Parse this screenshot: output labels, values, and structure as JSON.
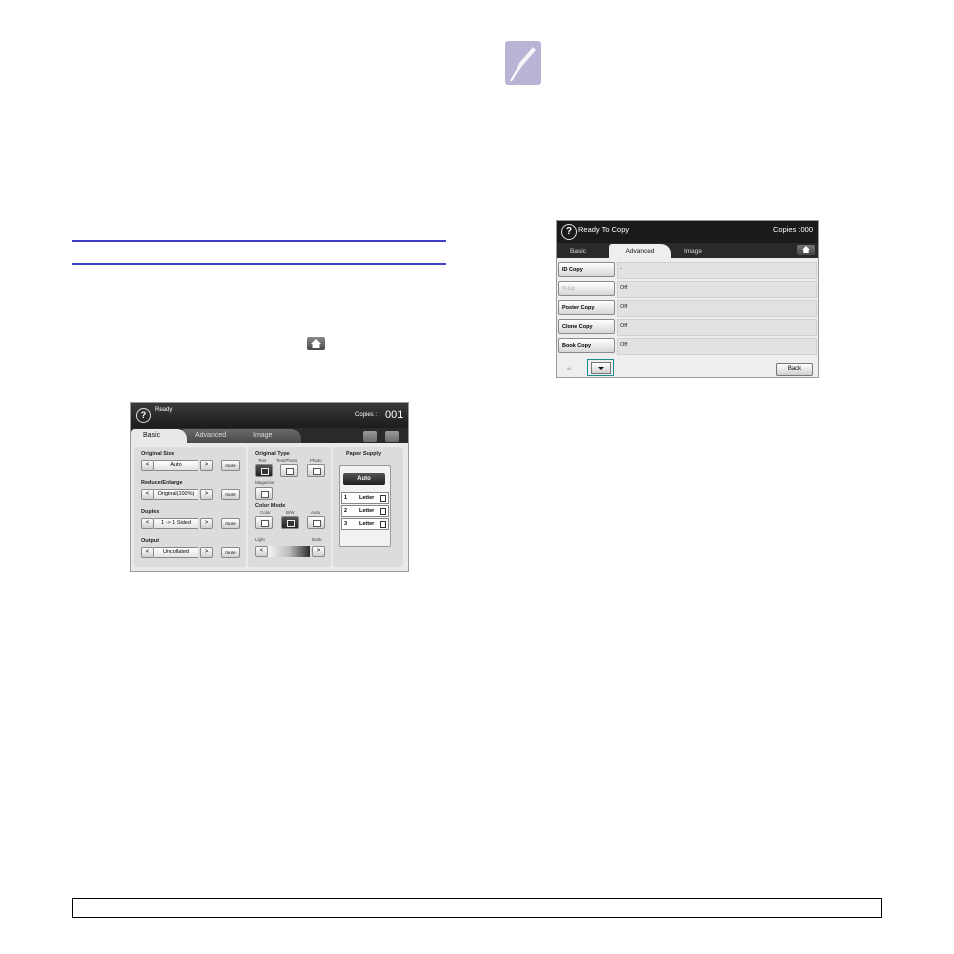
{
  "screen1": {
    "status": "Ready",
    "copies_label": "Copies :",
    "copies_value": "001",
    "tabs": [
      "Basic",
      "Advanced",
      "Image"
    ],
    "left_panel": [
      {
        "label": "Original Size",
        "value": "Auto",
        "more": "more"
      },
      {
        "label": "Reduce/Enlarge",
        "value": "Original(100%)",
        "more": "more"
      },
      {
        "label": "Duplex",
        "value": "1 -> 1 Sided",
        "more": "more"
      },
      {
        "label": "Output",
        "value": "Uncollated",
        "more": "more"
      }
    ],
    "original_type": {
      "label": "Original Type",
      "options": [
        "Text",
        "Text/Photo",
        "Photo"
      ],
      "magazine": "Magazine"
    },
    "color_mode": {
      "label": "Color Mode",
      "options": [
        "Color",
        "B/W",
        "Auto"
      ]
    },
    "density": {
      "light": "Light",
      "dark": "Dark"
    },
    "paper_supply": {
      "label": "Paper Supply",
      "auto": "Auto",
      "trays": [
        {
          "num": "1",
          "size": "Letter"
        },
        {
          "num": "2",
          "size": "Letter"
        },
        {
          "num": "3",
          "size": "Letter"
        }
      ]
    }
  },
  "screen2": {
    "status": "Ready To Copy",
    "copies": "Copies :000",
    "tabs": [
      "Basic",
      "Advanced",
      "Image"
    ],
    "rows": [
      {
        "button": "ID Copy",
        "value": "-"
      },
      {
        "button": "N-Up",
        "value": "Off"
      },
      {
        "button": "Poster Copy",
        "value": "Off"
      },
      {
        "button": "Clone Copy",
        "value": "Off"
      },
      {
        "button": "Book Copy",
        "value": "Off"
      }
    ],
    "back": "Back"
  }
}
